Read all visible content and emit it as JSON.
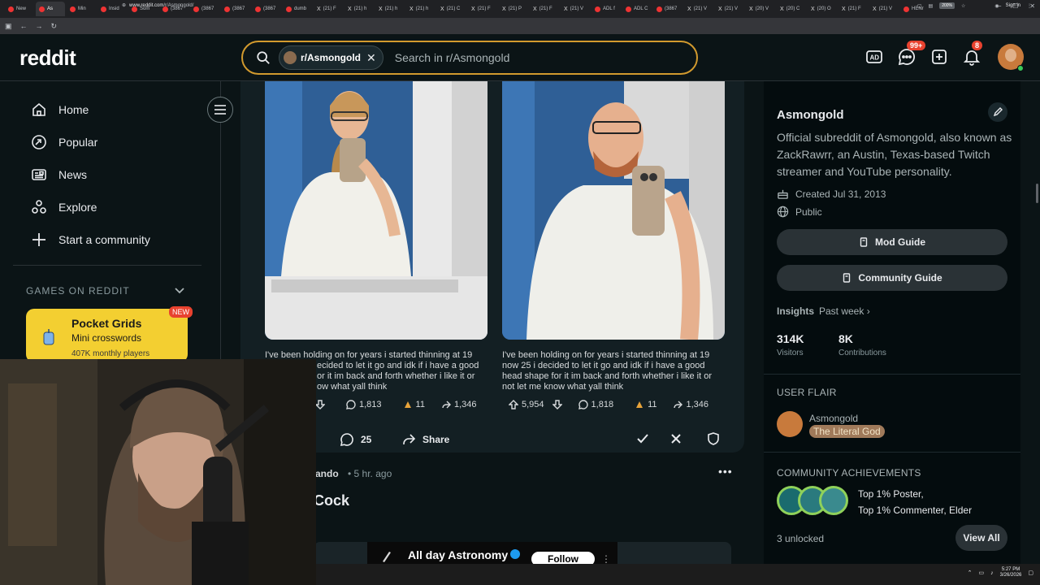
{
  "browser": {
    "tabs": [
      "New",
      "As",
      "Min",
      "Insid",
      "Som",
      "(3867",
      "(3867",
      "(3867",
      "(3867",
      "dumb",
      "(21) F",
      "(21) h",
      "(21) h",
      "(21) h",
      "(21) C",
      "(21) F",
      "(21) P",
      "(21) F",
      "(21) V",
      "ADL f",
      "ADL C",
      "(3867",
      "(21) V",
      "(21) V",
      "(20) V",
      "(20) C",
      "(20) O",
      "(21) F",
      "(21) V",
      "HENr"
    ],
    "url_host": "www.reddit.com",
    "url_path": "/r/Asmongold/",
    "zoom": "200%",
    "sign_in": "Sign in"
  },
  "header": {
    "logo": "reddit",
    "search_chip": "r/Asmongold",
    "search_placeholder": "Search in r/Asmongold",
    "chat_badge": "99+",
    "notif_badge": "8",
    "icons": [
      "advertise-icon",
      "chat-icon",
      "create-post-icon",
      "notifications-icon",
      "user-avatar"
    ]
  },
  "sidebar": {
    "nav": [
      {
        "label": "Home",
        "icon": "home-icon"
      },
      {
        "label": "Popular",
        "icon": "popular-icon"
      },
      {
        "label": "News",
        "icon": "news-icon"
      },
      {
        "label": "Explore",
        "icon": "explore-icon"
      },
      {
        "label": "Start a community",
        "icon": "plus-icon"
      }
    ],
    "games_label": "GAMES ON REDDIT",
    "game": {
      "title": "Pocket Grids",
      "subtitle": "Mini crosswords",
      "users": "407K monthly players",
      "badge": "NEW"
    }
  },
  "post": {
    "captions": [
      "I've been holding on for years i started thinning at 19 now 25 i decided to let it go and idk if i have a good head shape for it im back and forth whether i like it or not let me know what yall think",
      "I've been holding on for years i started thinning at 19 now 25 i decided to let it go and idk if i have a good head shape for it im back and forth whether i like it or not let me know what yall think"
    ],
    "caption_left_visible": [
      "I've been holding on for years i started thinning at 19",
      "ecided to let it go and idk if i have a good",
      "or it im back and forth whether i like it or",
      "ow what yall think"
    ],
    "caption_right_lines": [
      "I've been holding on for years i started thinning at 19",
      "now 25 i decided to let it go and idk if i have a good",
      "head shape for it im back and forth whether i like it or",
      "not let me know what yall think"
    ],
    "left_stats": {
      "comments": "1,813",
      "awards": "11",
      "shares": "1,346"
    },
    "right_stats": {
      "votes": "5,954",
      "comments": "1,818",
      "awards": "11",
      "shares": "1,346"
    },
    "comments": "25",
    "share_label": "Share"
  },
  "post2": {
    "author_visible": "ando",
    "time": "• 5 hr. ago",
    "title_visible": "Cock",
    "embed_name": "All day Astronomy",
    "follow_label": "Follow"
  },
  "about": {
    "title": "Asmongold",
    "description": "Official subreddit of Asmongold, also known as ZackRawrr, an Austin, Texas-based Twitch streamer and YouTube personality.",
    "created": "Created Jul 31, 2013",
    "visibility": "Public",
    "mod_guide": "Mod Guide",
    "community_guide": "Community Guide",
    "insights_label": "Insights",
    "insights_period": "Past week",
    "visitors_value": "314K",
    "visitors_label": "Visitors",
    "contrib_value": "8K",
    "contrib_label": "Contributions",
    "flair_section": "USER FLAIR",
    "flair_name": "Asmongold",
    "flair_tag": "The Literal God",
    "achievements_section": "COMMUNITY ACHIEVEMENTS",
    "achievement_1": "Top 1% Poster,",
    "achievement_2": "Top 1% Commenter, Elder",
    "unlocked": "3 unlocked",
    "view_all": "View All"
  },
  "taskbar": {
    "time": "5:27 PM",
    "date": "3/26/2026"
  },
  "colors": {
    "bg": "#0b1416",
    "search_border": "#d29a2e",
    "game_card": "#f3cf31",
    "badge": "#e8422f",
    "flair": "#a07a5a"
  }
}
